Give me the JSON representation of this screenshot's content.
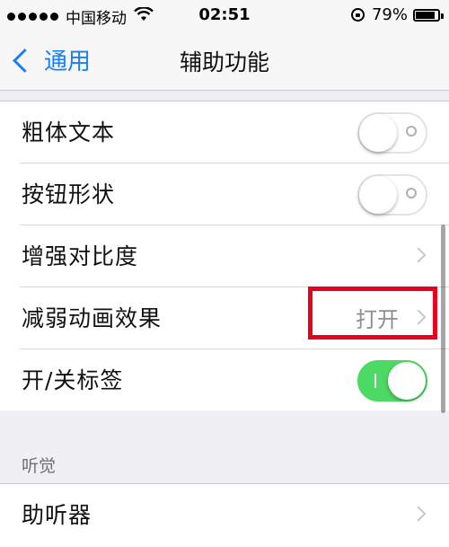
{
  "status_bar": {
    "carrier": "中国移动",
    "time": "02:51",
    "battery_percent": "79%",
    "battery_level": 0.79,
    "signal_dots": 5
  },
  "nav": {
    "back_label": "通用",
    "title": "辅助功能"
  },
  "settings": {
    "bold_text": {
      "label": "粗体文本",
      "on": false
    },
    "button_shapes": {
      "label": "按钮形状",
      "on": false
    },
    "increase_contrast": {
      "label": "增强对比度"
    },
    "reduce_motion": {
      "label": "减弱动画效果",
      "value": "打开"
    },
    "on_off_labels": {
      "label": "开/关标签",
      "on": true
    }
  },
  "hearing_section": {
    "header": "听觉",
    "hearing_aids": {
      "label": "助听器"
    }
  },
  "colors": {
    "accent": "#1a7ff2",
    "switch_on": "#4cd964",
    "highlight": "#e8001c"
  }
}
